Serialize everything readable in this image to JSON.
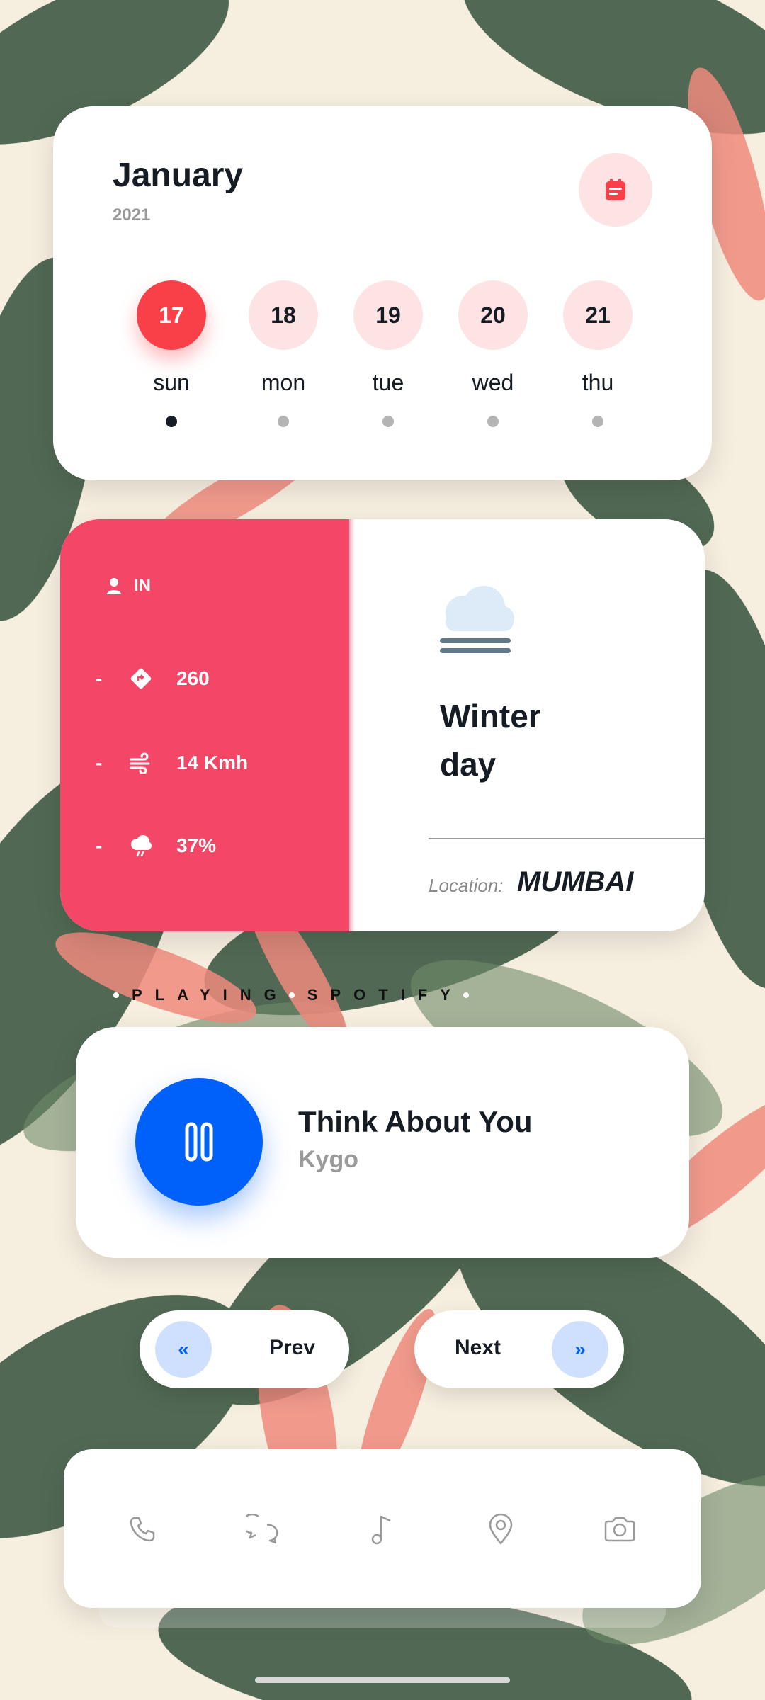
{
  "calendar": {
    "month": "January",
    "year": "2021",
    "days": [
      {
        "num": "17",
        "label": "sun",
        "active": true
      },
      {
        "num": "18",
        "label": "mon",
        "active": false
      },
      {
        "num": "19",
        "label": "tue",
        "active": false
      },
      {
        "num": "20",
        "label": "wed",
        "active": false
      },
      {
        "num": "21",
        "label": "thu",
        "active": false
      }
    ]
  },
  "weather": {
    "country": "IN",
    "rows": [
      {
        "dash": "-",
        "icon": "direction-icon",
        "value": "260"
      },
      {
        "dash": "-",
        "icon": "wind-icon",
        "value": "14 Kmh"
      },
      {
        "dash": "-",
        "icon": "rain-cloud-icon",
        "value": "37%"
      }
    ],
    "condition_line1": "Winter",
    "condition_line2": "day",
    "location_label": "Location:",
    "location_value": "MUMBAI"
  },
  "playing": {
    "word1": "PLAYING",
    "word2": "SPOTIFY"
  },
  "music": {
    "title": "Think About You",
    "artist": "Kygo"
  },
  "controls": {
    "prev_label": "Prev",
    "next_label": "Next",
    "prev_glyph": "«",
    "next_glyph": "»"
  },
  "dock": {
    "icons": [
      "phone-icon",
      "chat-icon",
      "music-note-icon",
      "location-pin-icon",
      "camera-icon"
    ]
  },
  "colors": {
    "accent_red": "#f94049",
    "weather_pink": "#f44768",
    "music_blue": "#0061fa",
    "text_dark": "#161c24"
  }
}
